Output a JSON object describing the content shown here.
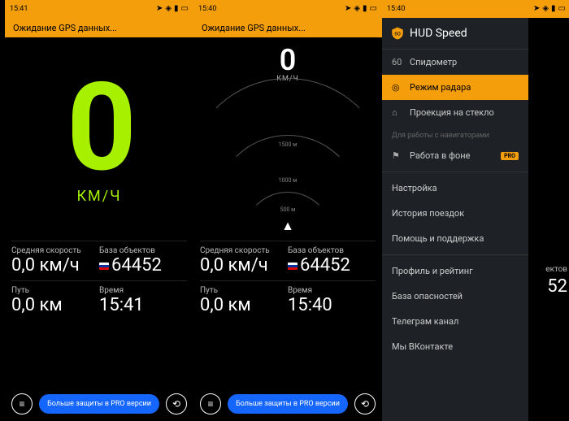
{
  "statusbar": {
    "time1": "15:41",
    "time2": "15:40",
    "time3": "15:40"
  },
  "header": {
    "waiting": "Ожидание GPS данных..."
  },
  "speedo": {
    "value": "0",
    "unit": "КМ/Ч"
  },
  "radar": {
    "value": "0",
    "unit": "КМ/Ч",
    "ring1": "500 м",
    "ring2": "1000 м",
    "ring3": "1500 м"
  },
  "stats": {
    "avg_label": "Средняя скорость",
    "avg_value": "0,0 км/ч",
    "db_label": "База объектов",
    "db_value": "64452",
    "dist_label": "Путь",
    "dist_value": "0,0 км",
    "time_label": "Время",
    "time_value1": "15:41",
    "time_value2": "15:40"
  },
  "bottom": {
    "pro_msg": "Больше защиты в PRO версии"
  },
  "drawer": {
    "title": "HUD Speed",
    "shield_value": "60",
    "items": {
      "speedometer": "Спидометр",
      "radar": "Режим радара",
      "hud": "Проекция на стекло",
      "section_nav": "Для работы с навигаторами",
      "background": "Работа в фоне",
      "pro_badge": "PRO",
      "settings": "Настройка",
      "history": "История поездок",
      "help": "Помощь и поддержка",
      "profile": "Профиль и рейтинг",
      "hazards": "База опасностей",
      "telegram": "Телеграм канал",
      "vk": "Мы ВКонтакте"
    }
  },
  "sliver": {
    "db_label_short": "ектов",
    "db_value_short": "52"
  }
}
